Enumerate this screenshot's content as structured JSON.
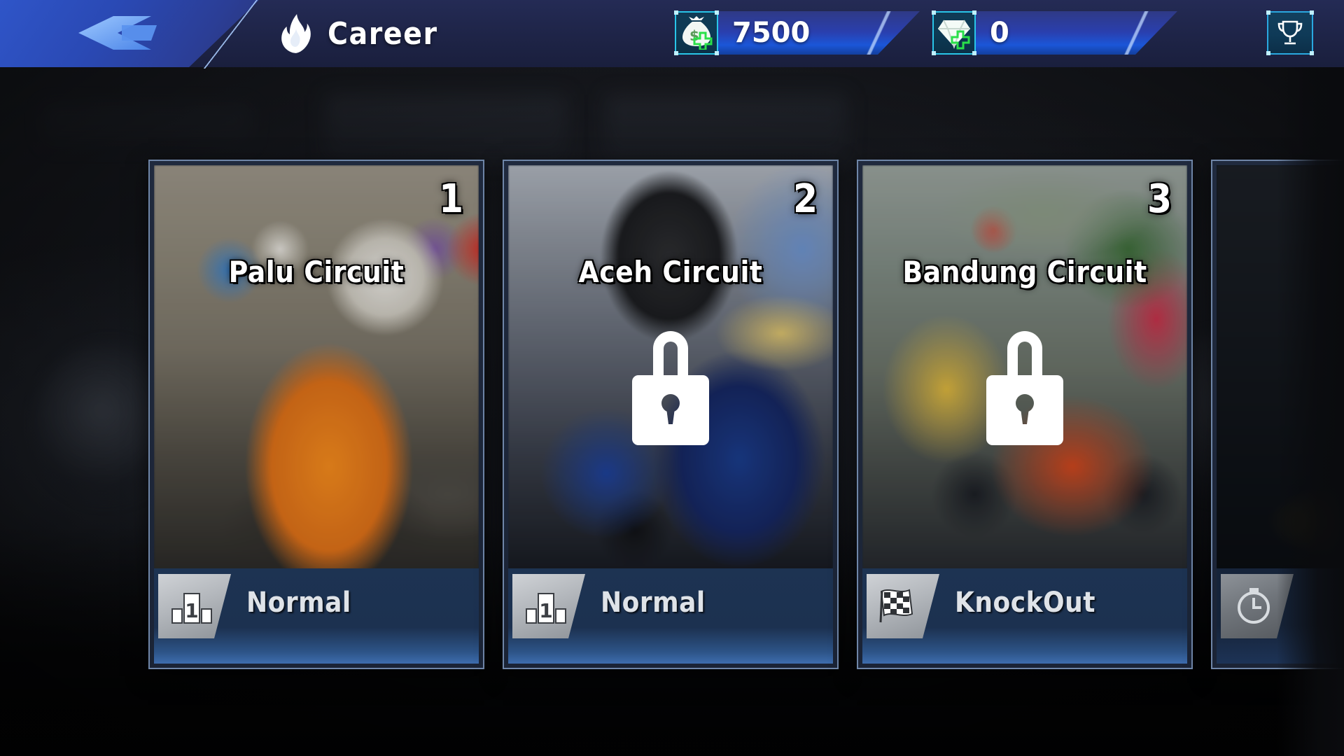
{
  "header": {
    "back_icon": "back-arrow-icon",
    "flame_icon": "flame-icon",
    "title": "Career",
    "money": {
      "icon": "money-bag-plus-icon",
      "value": "7500"
    },
    "gems": {
      "icon": "diamond-plus-icon",
      "value": "0"
    },
    "trophy_button": {
      "icon": "trophy-icon"
    }
  },
  "colors": {
    "accent_cyan": "#29c5e8",
    "header_blue": "#2f55c8",
    "card_border": "#6f86a8",
    "meta_blue": "#1d3352",
    "green_plus": "#35d14a"
  },
  "tracks": [
    {
      "number": "1",
      "name": "Palu Circuit",
      "mode": "Normal",
      "mode_icon": "podium-first-place-icon",
      "locked": false,
      "lock_icon": ""
    },
    {
      "number": "2",
      "name": "Aceh Circuit",
      "mode": "Normal",
      "mode_icon": "podium-first-place-icon",
      "locked": true,
      "lock_icon": "padlock-icon"
    },
    {
      "number": "3",
      "name": "Bandung Circuit",
      "mode": "KnockOut",
      "mode_icon": "checkered-flag-icon",
      "locked": true,
      "lock_icon": "padlock-icon"
    },
    {
      "number": "",
      "name": "",
      "mode": "",
      "mode_icon": "stopwatch-icon",
      "locked": true,
      "lock_icon": ""
    }
  ]
}
